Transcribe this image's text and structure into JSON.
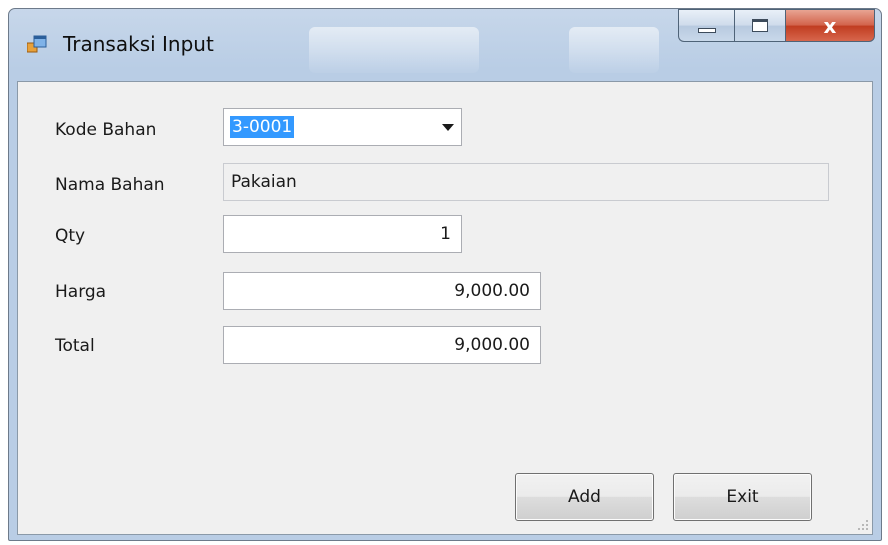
{
  "window": {
    "title": "Transaksi Input",
    "controls": {
      "minimize": "minimize",
      "maximize": "maximize",
      "close": "x"
    }
  },
  "form": {
    "kode_bahan": {
      "label": "Kode Bahan",
      "value": "3-0001"
    },
    "nama_bahan": {
      "label": "Nama Bahan",
      "value": "Pakaian"
    },
    "qty": {
      "label": "Qty",
      "value": "1"
    },
    "harga": {
      "label": "Harga",
      "value": "9,000.00"
    },
    "total": {
      "label": "Total",
      "value": "9,000.00"
    }
  },
  "buttons": {
    "add": "Add",
    "exit": "Exit"
  },
  "icons": [
    "app-icon",
    "chevron-down-icon",
    "resize-grip-icon"
  ]
}
